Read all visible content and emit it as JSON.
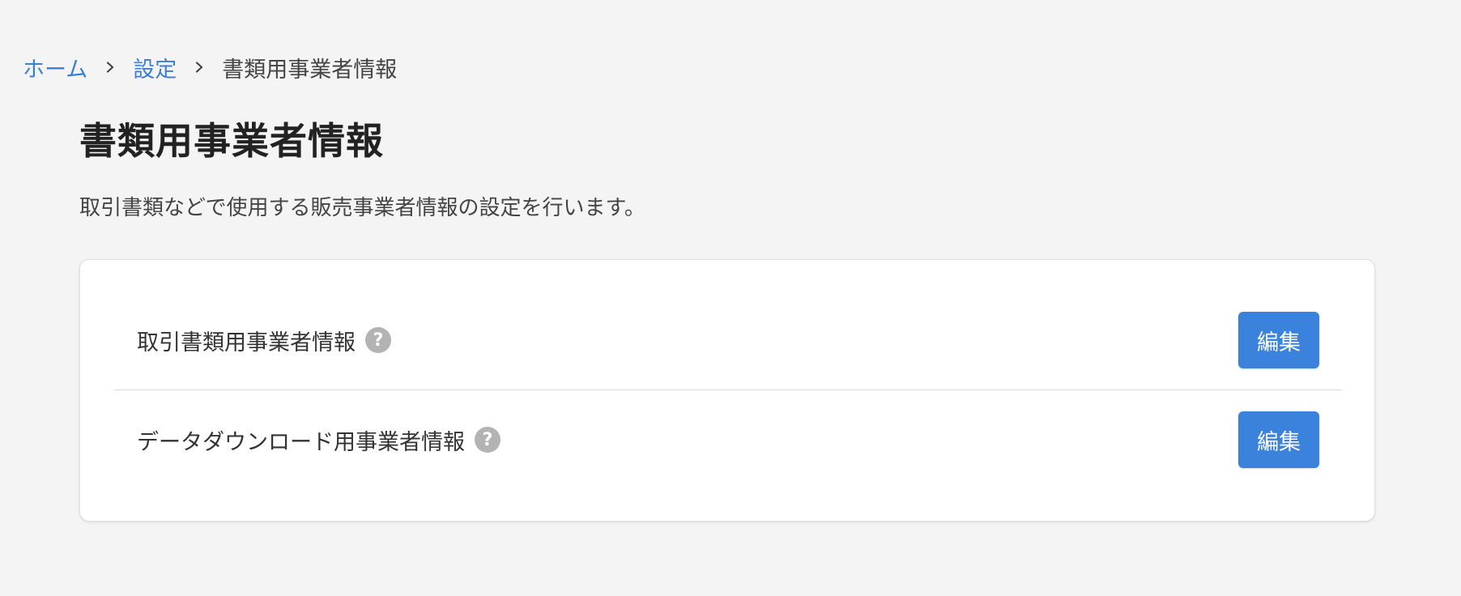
{
  "breadcrumb": {
    "items": [
      {
        "label": "ホーム"
      },
      {
        "label": "設定"
      },
      {
        "label": "書類用事業者情報"
      }
    ]
  },
  "page": {
    "title": "書類用事業者情報",
    "description": "取引書類などで使用する販売事業者情報の設定を行います。"
  },
  "settings": {
    "rows": [
      {
        "label": "取引書類用事業者情報",
        "help_icon": "?",
        "button_label": "編集"
      },
      {
        "label": "データダウンロード用事業者情報",
        "help_icon": "?",
        "button_label": "編集"
      }
    ]
  },
  "colors": {
    "link": "#3b7fd8",
    "button": "#3b82dc",
    "help_icon": "#b3b3b3",
    "background": "#f4f4f4"
  }
}
